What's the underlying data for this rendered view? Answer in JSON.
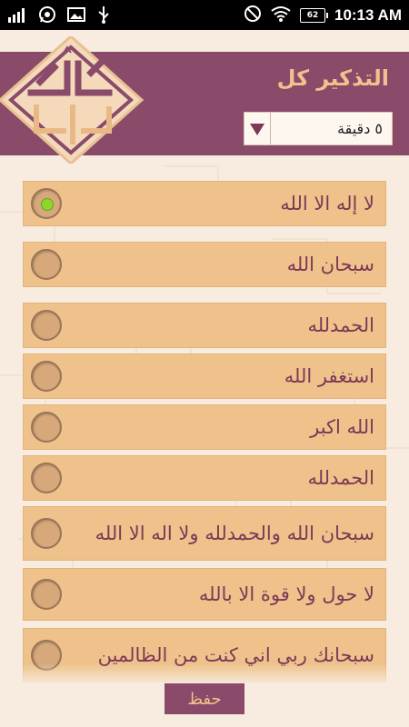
{
  "status_bar": {
    "time": "10:13 AM",
    "battery": "62",
    "icons": [
      "signal-icon",
      "whatsapp-icon",
      "image-icon",
      "usb-icon",
      "do-not-disturb-icon",
      "wifi-icon",
      "battery-icon"
    ]
  },
  "header": {
    "title": "التذكير كل",
    "dropdown_value": "٥ دقيقة"
  },
  "items": [
    {
      "label": "لا إله الا الله",
      "selected": true
    },
    {
      "label": "سبحان الله",
      "selected": false
    },
    {
      "label": "الحمدلله",
      "selected": false
    },
    {
      "label": "استغفر الله",
      "selected": false
    },
    {
      "label": "الله اكبر",
      "selected": false
    },
    {
      "label": "الحمدلله",
      "selected": false
    },
    {
      "label": "سبحان الله والحمدلله ولا اله الا الله",
      "selected": false
    },
    {
      "label": "لا حول ولا قوة الا بالله",
      "selected": false
    },
    {
      "label": "سبحانك ربي اني كنت من الظالمين",
      "selected": false
    }
  ],
  "footer": {
    "save_label": "حفظ"
  },
  "colors": {
    "accent": "#8a4a6a",
    "gold": "#efc28d",
    "item_bg": "#eec28a",
    "text": "#7d3857"
  }
}
